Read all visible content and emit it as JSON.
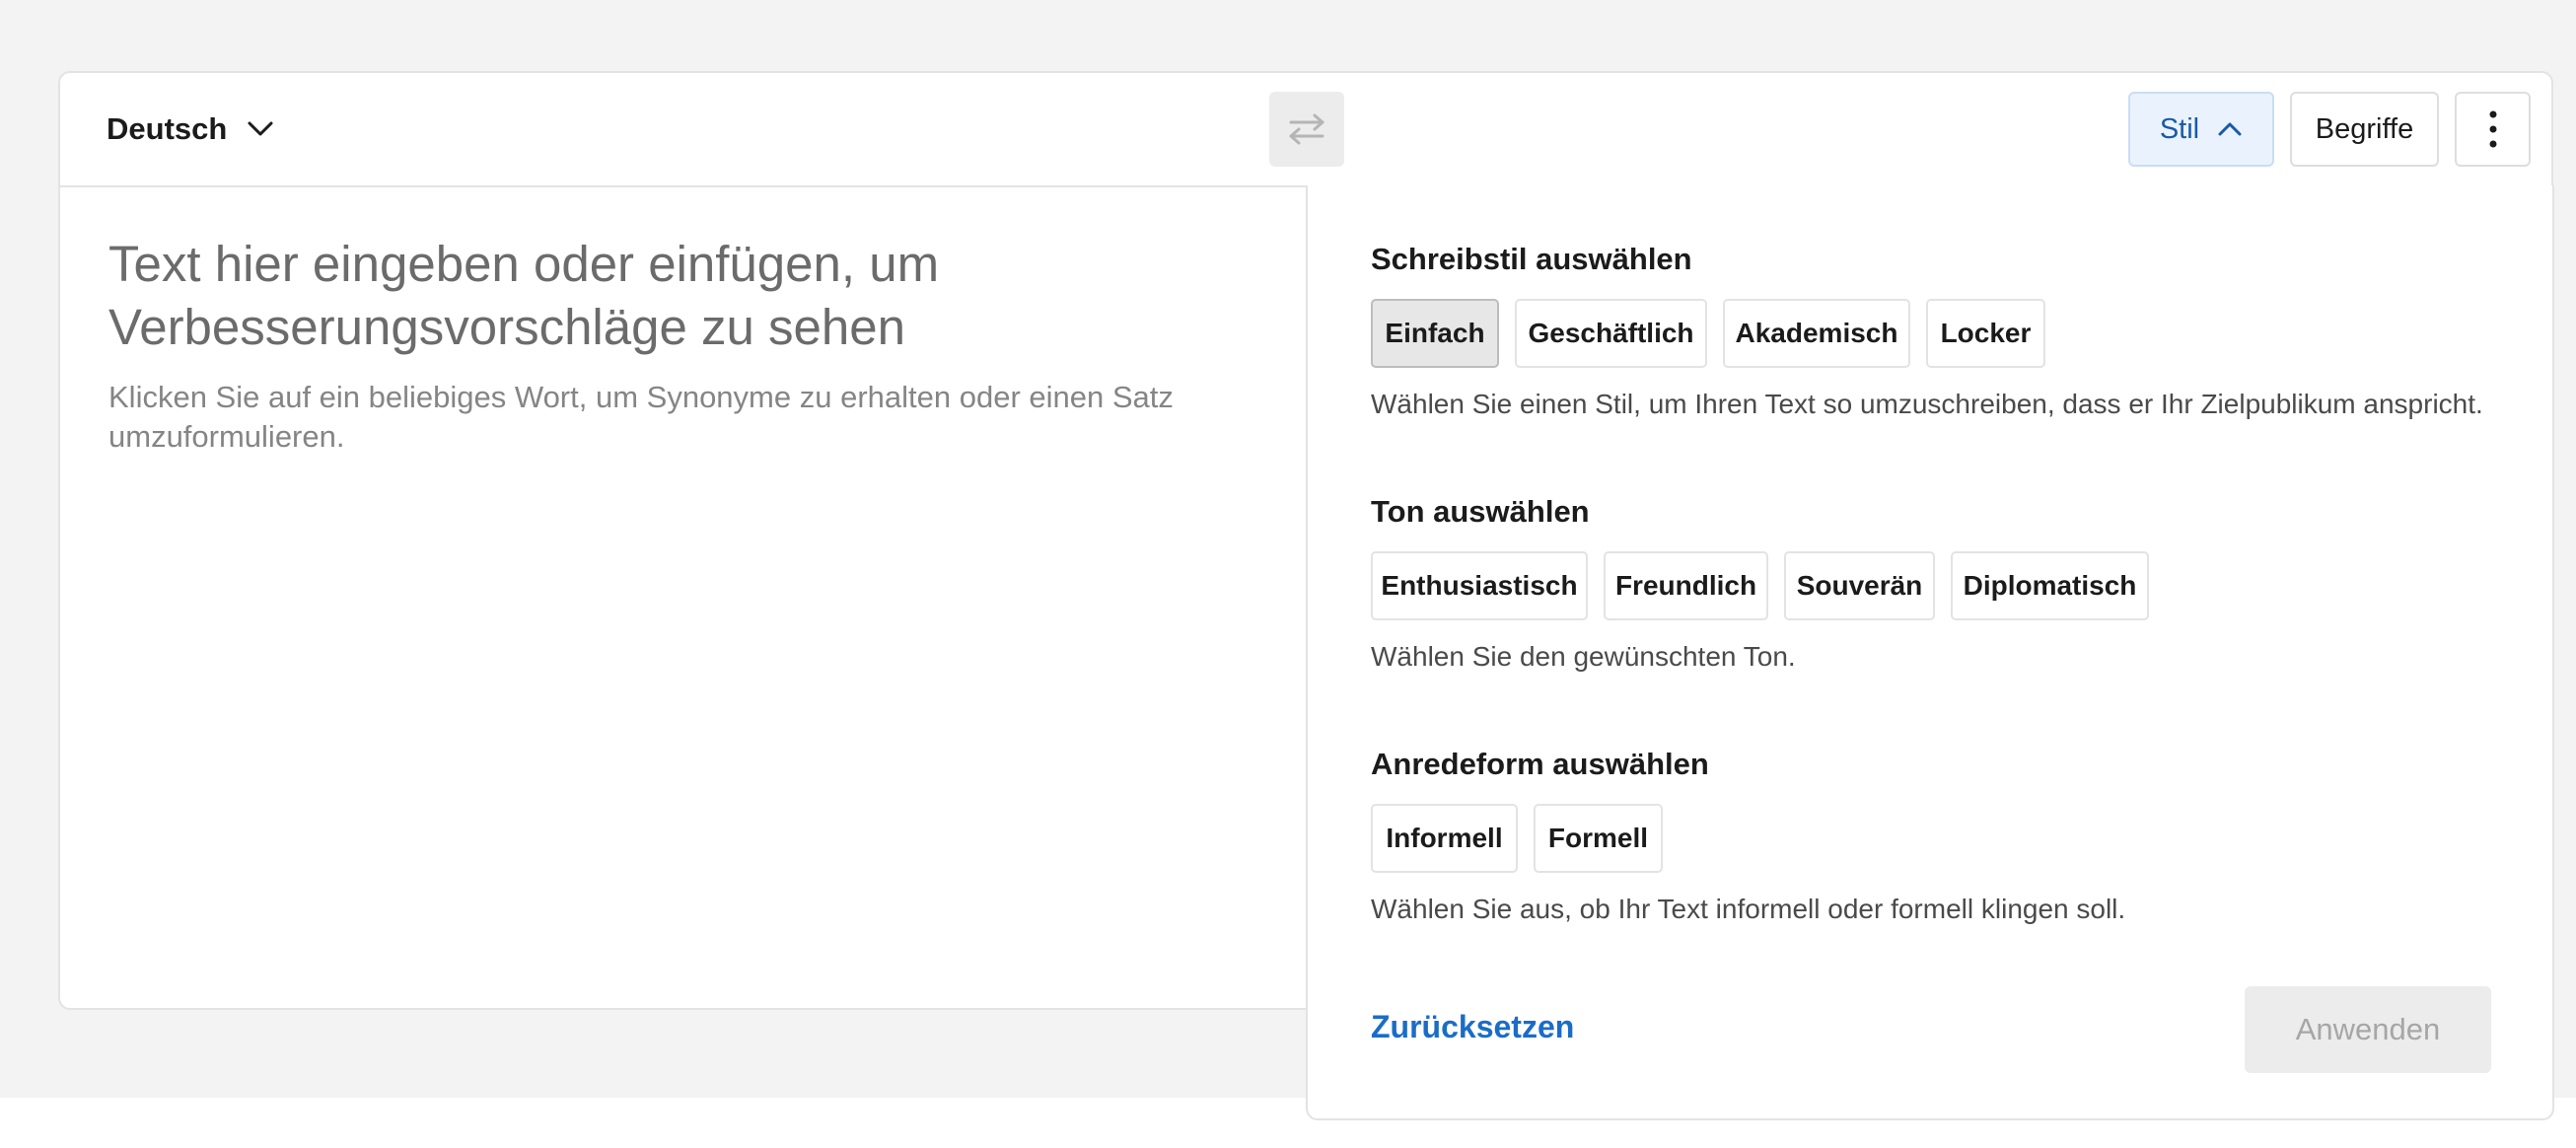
{
  "header": {
    "language": "Deutsch",
    "style_button": "Stil",
    "terms_button": "Begriffe"
  },
  "editor": {
    "placeholder": "Text hier eingeben oder einfügen, um Verbesserungsvorschläge zu sehen",
    "hint": "Klicken Sie auf ein beliebiges Wort, um Synonyme zu erhalten oder einen Satz umzuformulieren."
  },
  "style_panel": {
    "writing_style": {
      "title": "Schreibstil auswählen",
      "options": [
        "Einfach",
        "Geschäftlich",
        "Akademisch",
        "Locker"
      ],
      "selected": "Einfach",
      "description": "Wählen Sie einen Stil, um Ihren Text so umzuschreiben, dass er Ihr Zielpublikum anspricht."
    },
    "tone": {
      "title": "Ton auswählen",
      "options": [
        "Enthusiastisch",
        "Freundlich",
        "Souverän",
        "Diplomatisch"
      ],
      "description": "Wählen Sie den gewünschten Ton."
    },
    "address_form": {
      "title": "Anredeform auswählen",
      "options": [
        "Informell",
        "Formell"
      ],
      "description": "Wählen Sie aus, ob Ihr Text informell oder formell klingen soll."
    },
    "reset_label": "Zurücksetzen",
    "apply_label": "Anwenden"
  },
  "colors": {
    "accent": "#1a6dc7",
    "style_button_bg": "#eaf3fd",
    "selected_chip_bg": "#e7e7e7",
    "disabled_button_bg": "#ececec"
  },
  "icons": {
    "language_dropdown": "chevron-down-icon",
    "swap": "swap-arrows-icon",
    "style_toggle": "chevron-up-icon",
    "more": "more-vertical-icon"
  }
}
